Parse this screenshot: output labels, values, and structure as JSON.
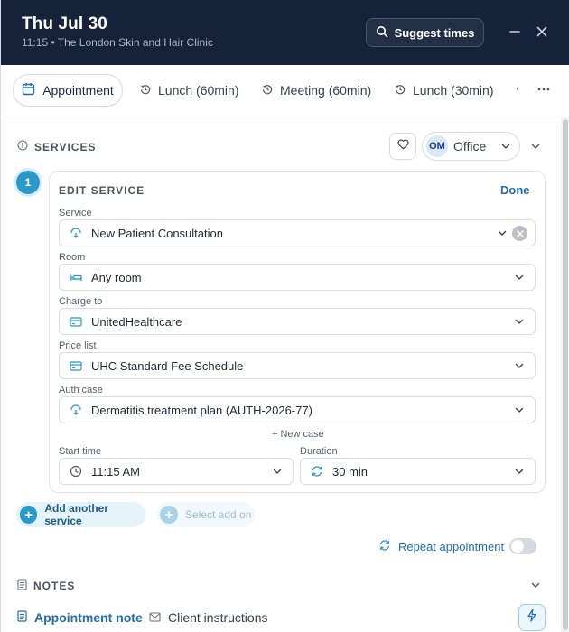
{
  "header": {
    "title": "Thu Jul 30",
    "subtitle": "11:15 • The London Skin and Hair Clinic",
    "suggest_label": "Suggest times"
  },
  "tabs": [
    {
      "label": "Appointment",
      "active": true
    },
    {
      "label": "Lunch (60min)"
    },
    {
      "label": "Meeting (60min)"
    },
    {
      "label": "Lunch (30min)"
    }
  ],
  "services": {
    "heading": "SERVICES",
    "office_initials": "OM",
    "office_label": "Office",
    "step_number": "1",
    "edit_title": "EDIT SERVICE",
    "done_label": "Done",
    "fields": {
      "service": {
        "label": "Service",
        "value": "New Patient Consultation"
      },
      "room": {
        "label": "Room",
        "value": "Any room"
      },
      "charge_to": {
        "label": "Charge to",
        "value": "UnitedHealthcare"
      },
      "price_list": {
        "label": "Price list",
        "value": "UHC Standard Fee Schedule"
      },
      "auth_case": {
        "label": "Auth case",
        "value": "Dermatitis treatment plan (AUTH-2026-77)"
      },
      "start_time": {
        "label": "Start time",
        "value": "11:15 AM"
      },
      "duration": {
        "label": "Duration",
        "value": "30 min"
      }
    },
    "new_case_label": "+ New case",
    "add_service_label": "Add another service",
    "select_addon_label": "Select add on",
    "repeat_label": "Repeat appointment"
  },
  "notes": {
    "heading": "NOTES",
    "tab_note": "Appointment note",
    "tab_client": "Client instructions"
  },
  "colors": {
    "header_bg": "#16213a",
    "accent": "#1e6fb1",
    "step": "#2a98c9"
  }
}
